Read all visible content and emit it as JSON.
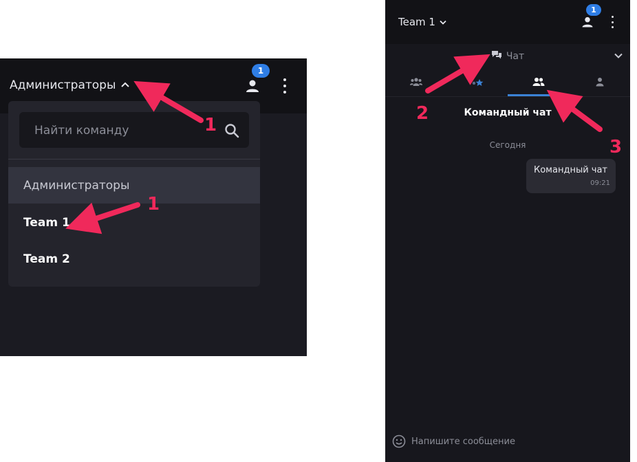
{
  "left": {
    "team_selector_label": "Администраторы",
    "notification_count": "1",
    "search": {
      "placeholder": "Найти команду"
    },
    "teams": [
      "Администраторы",
      "Team 1",
      "Team 2"
    ]
  },
  "right": {
    "team_selector_label": "Team 1",
    "notification_count": "1",
    "chat_header": "Чат",
    "tabs": [
      {
        "icon": "group-icon"
      },
      {
        "icon": "star-icon"
      },
      {
        "icon": "team-icon",
        "active": true
      },
      {
        "icon": "person-icon"
      }
    ],
    "chat_title": "Командный чат",
    "date_separator": "Сегодня",
    "message": {
      "text": "Командный чат",
      "time": "09:21"
    },
    "composer_placeholder": "Напишите сообщение"
  },
  "annotations": {
    "label_1": "1",
    "label_2": "2",
    "label_3": "3"
  },
  "colors": {
    "accent": "#2f7ee6",
    "annotation": "#f0295b",
    "panel_bg": "#17171d"
  }
}
